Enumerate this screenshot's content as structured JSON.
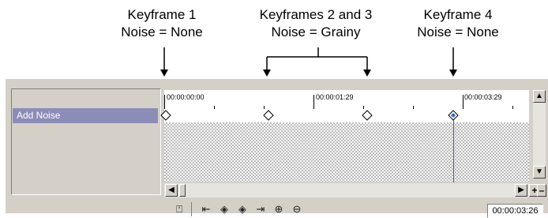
{
  "annotations": {
    "kf1": {
      "line1": "Keyframe 1",
      "line2": "Noise = None"
    },
    "kf23": {
      "line1": "Keyframes 2 and 3",
      "line2": "Noise = Grainy"
    },
    "kf4": {
      "line1": "Keyframe 4",
      "line2": "Noise = None"
    }
  },
  "timeline": {
    "track_name": "Add Noise",
    "ruler": [
      "00:00:00:00",
      "00:00:01:29",
      "00:00:03:29"
    ],
    "current_time": "00:00:03:26"
  },
  "controls": {
    "plus": "+",
    "minus": "–"
  },
  "colors": {
    "panel": "#d4d0c8",
    "track_label": "#8c8cb8",
    "cursor": "#3a64c8"
  },
  "icons": [
    "lock-layer-icon",
    "go-to-start-icon",
    "previous-keyframe-icon",
    "next-keyframe-icon",
    "go-to-end-icon",
    "add-keyframe-icon",
    "delete-keyframe-icon"
  ]
}
